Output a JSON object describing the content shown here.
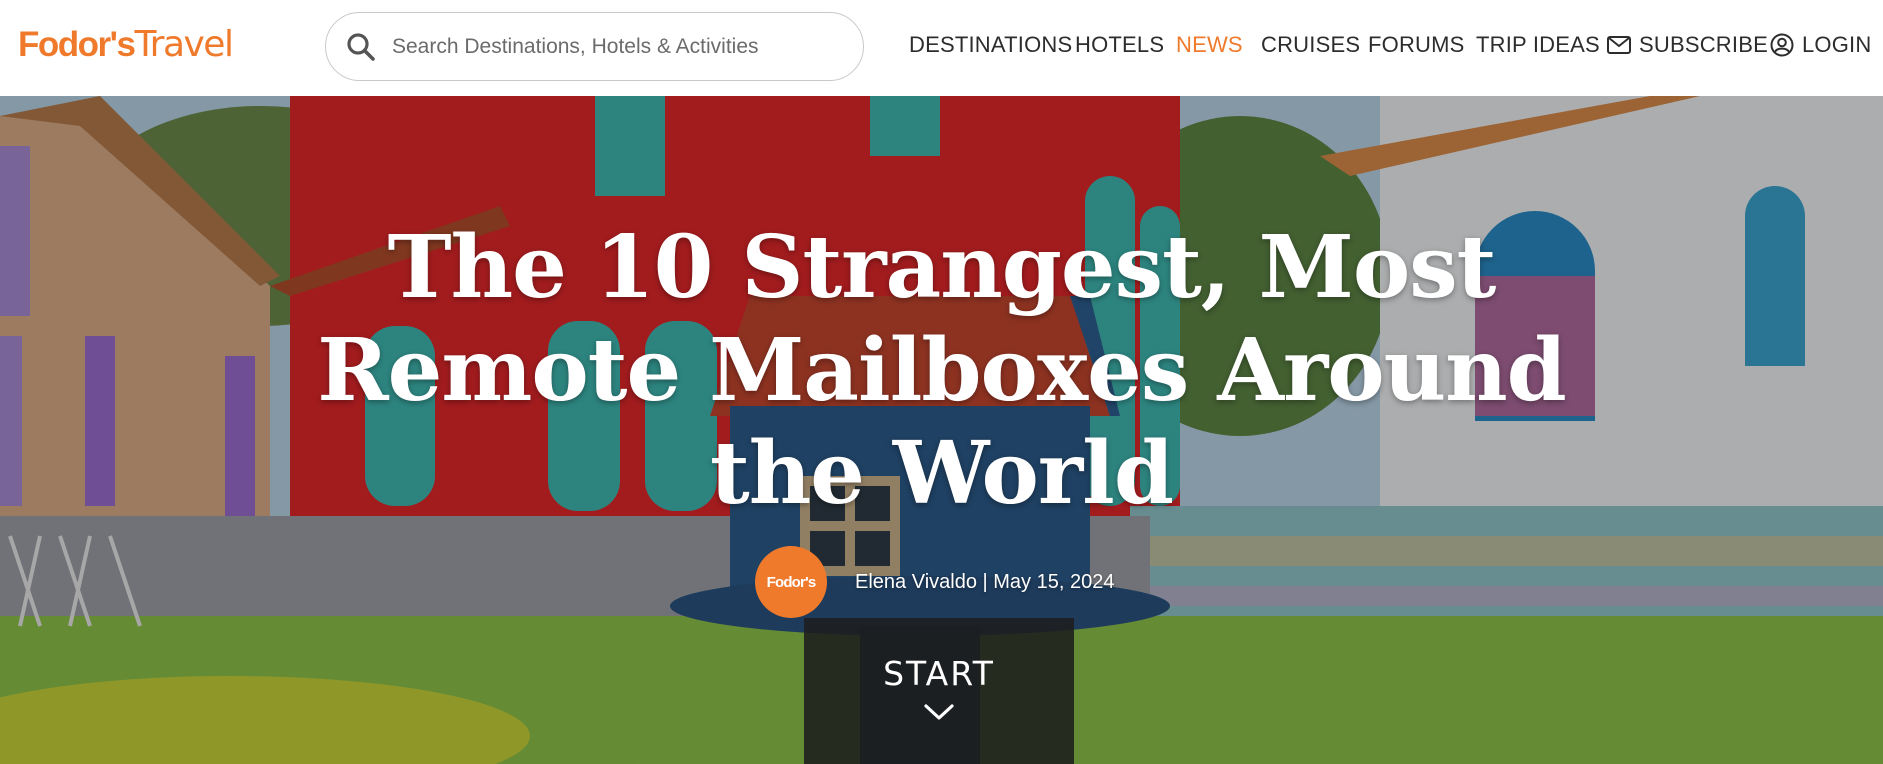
{
  "header": {
    "logo": {
      "brand": "Fodor's",
      "travel": "Travel"
    },
    "search": {
      "placeholder": "Search Destinations, Hotels & Activities",
      "icon": "search-icon"
    },
    "nav": [
      {
        "label": "DESTINATIONS",
        "active": false
      },
      {
        "label": "HOTELS",
        "active": false
      },
      {
        "label": "NEWS",
        "active": true
      },
      {
        "label": "CRUISES",
        "active": false
      },
      {
        "label": "FORUMS",
        "active": false
      },
      {
        "label": "TRIP IDEAS",
        "active": false
      },
      {
        "label": "SUBSCRIBE",
        "active": false,
        "icon": "mail-icon"
      },
      {
        "label": "LOGIN",
        "active": false,
        "icon": "user-icon"
      }
    ]
  },
  "hero": {
    "title": "The 10 Strangest, Most Remote Mailboxes Around the World",
    "avatar_text": "Fodor's",
    "byline": "Elena Vivaldo | May 15, 2024",
    "start_label": "START"
  },
  "colors": {
    "brand_orange": "#f07a2c",
    "nav_text": "#2d2d2d",
    "active_nav": "#f07a2c"
  }
}
